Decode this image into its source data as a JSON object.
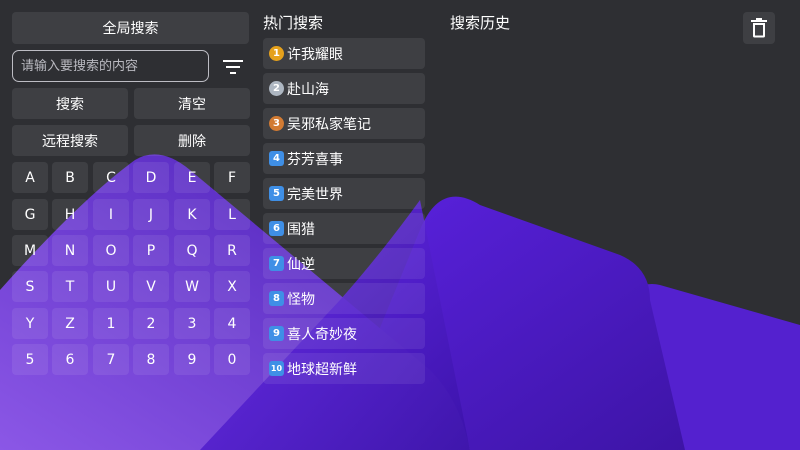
{
  "left_panel": {
    "title": "全局搜索",
    "search": {
      "placeholder": "请输入要搜索的内容",
      "value": ""
    },
    "filter_icon": "filter-icon",
    "buttons": {
      "search": "搜索",
      "clear": "清空",
      "remote_search": "远程搜索",
      "delete": "删除"
    },
    "keys": [
      "A",
      "B",
      "C",
      "D",
      "E",
      "F",
      "G",
      "H",
      "I",
      "J",
      "K",
      "L",
      "M",
      "N",
      "O",
      "P",
      "Q",
      "R",
      "S",
      "T",
      "U",
      "V",
      "W",
      "X",
      "Y",
      "Z",
      "1",
      "2",
      "3",
      "4",
      "5",
      "6",
      "7",
      "8",
      "9",
      "0"
    ]
  },
  "hot_search": {
    "title": "热门搜索",
    "items": [
      {
        "rank": "1",
        "label": "许我耀眼",
        "badge": "gold-medal-icon"
      },
      {
        "rank": "2",
        "label": "赴山海",
        "badge": "silver-medal-icon"
      },
      {
        "rank": "3",
        "label": "吴邪私家笔记",
        "badge": "bronze-medal-icon"
      },
      {
        "rank": "4",
        "label": "芬芳喜事",
        "badge": "number-badge-icon"
      },
      {
        "rank": "5",
        "label": "完美世界",
        "badge": "number-badge-icon"
      },
      {
        "rank": "6",
        "label": "围猎",
        "badge": "number-badge-icon"
      },
      {
        "rank": "7",
        "label": "仙逆",
        "badge": "number-badge-icon"
      },
      {
        "rank": "8",
        "label": "怪物",
        "badge": "number-badge-icon"
      },
      {
        "rank": "9",
        "label": "喜人奇妙夜",
        "badge": "number-badge-icon"
      },
      {
        "rank": "10",
        "label": "地球超新鲜",
        "badge": "number-badge-icon"
      }
    ]
  },
  "history": {
    "title": "搜索历史",
    "delete_icon": "trash-icon"
  },
  "colors": {
    "background": "#2e2f33",
    "purple_light": "#8a4fe0",
    "purple_mid": "#5a1fd6",
    "purple_dark": "#3b0fa3",
    "number_badge": "#3f8fe6"
  }
}
